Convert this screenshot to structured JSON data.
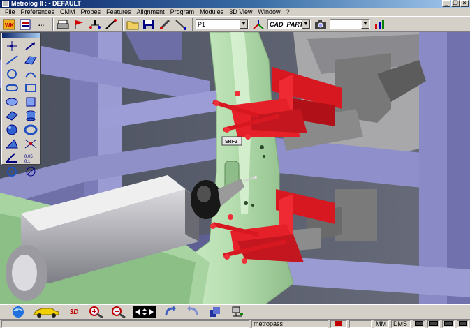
{
  "window": {
    "title": "Metrolog II : - DEFAULT",
    "controls": [
      "_",
      "❐",
      "×"
    ]
  },
  "menu": [
    "File",
    "Preferences",
    "CMM",
    "Probes",
    "Features",
    "Alignment",
    "Program",
    "Modules",
    "3D View",
    "Window",
    "?"
  ],
  "toolbar": {
    "point_combo": "P1",
    "cad_combo": "CAD_PART",
    "empty_combo": "",
    "wk_label": "WK",
    "ellipsis": "..."
  },
  "viewport": {
    "ref_label": "SRF2",
    "colors": {
      "part": "#b8e0b4",
      "frame": "#8f90c8",
      "clamp": "#e0202a",
      "arm": "#bcbcc0",
      "background": "#555a6a"
    }
  },
  "bottom_toolbar": {
    "view_3d_label": "3D"
  },
  "status": {
    "field1": "",
    "user": "metropass",
    "units": "MM",
    "angle": "DMS"
  }
}
